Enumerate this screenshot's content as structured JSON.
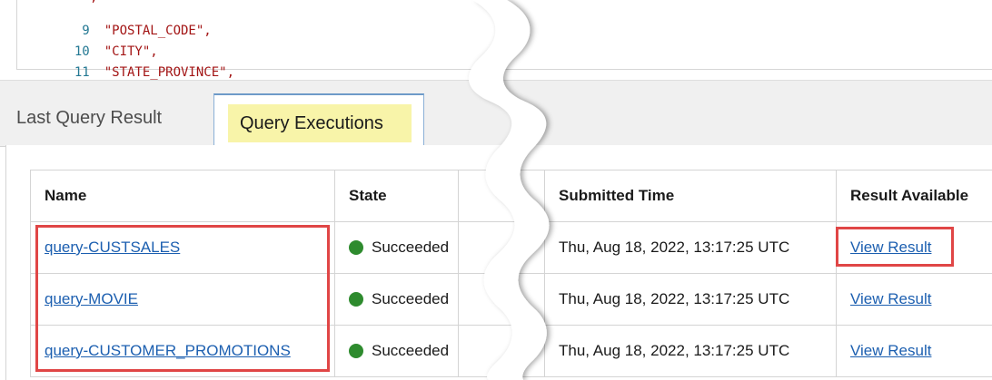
{
  "editor": {
    "top_fragment": ",",
    "lines": [
      {
        "number": "9",
        "text": "\"POSTAL_CODE\","
      },
      {
        "number": "10",
        "text": "\"CITY\","
      },
      {
        "number": "11",
        "text": "\"STATE_PROVINCE\","
      }
    ]
  },
  "tabs": {
    "last_query_result": "Last Query Result",
    "query_executions": "Query Executions"
  },
  "table": {
    "headers": {
      "name": "Name",
      "state": "State",
      "submitted_time": "Submitted Time",
      "result_available": "Result Available"
    },
    "rows": [
      {
        "name": "query-CUSTSALES",
        "state": "Succeeded",
        "submitted_time": "Thu, Aug 18, 2022, 13:17:25 UTC",
        "result": "View Result"
      },
      {
        "name": "query-MOVIE",
        "state": "Succeeded",
        "submitted_time": "Thu, Aug 18, 2022, 13:17:25 UTC",
        "result": "View Result"
      },
      {
        "name": "query-CUSTOMER_PROMOTIONS",
        "state": "Succeeded",
        "submitted_time": "Thu, Aug 18, 2022, 13:17:25 UTC",
        "result": "View Result"
      }
    ]
  },
  "colors": {
    "link": "#1c5fb0",
    "status_success": "#2e8b2e",
    "highlight": "#f8f4a9",
    "annotation": "#e04646",
    "code_string": "#a31515",
    "line_number": "#237893"
  },
  "icons": {
    "status": "status-success-dot-icon"
  }
}
